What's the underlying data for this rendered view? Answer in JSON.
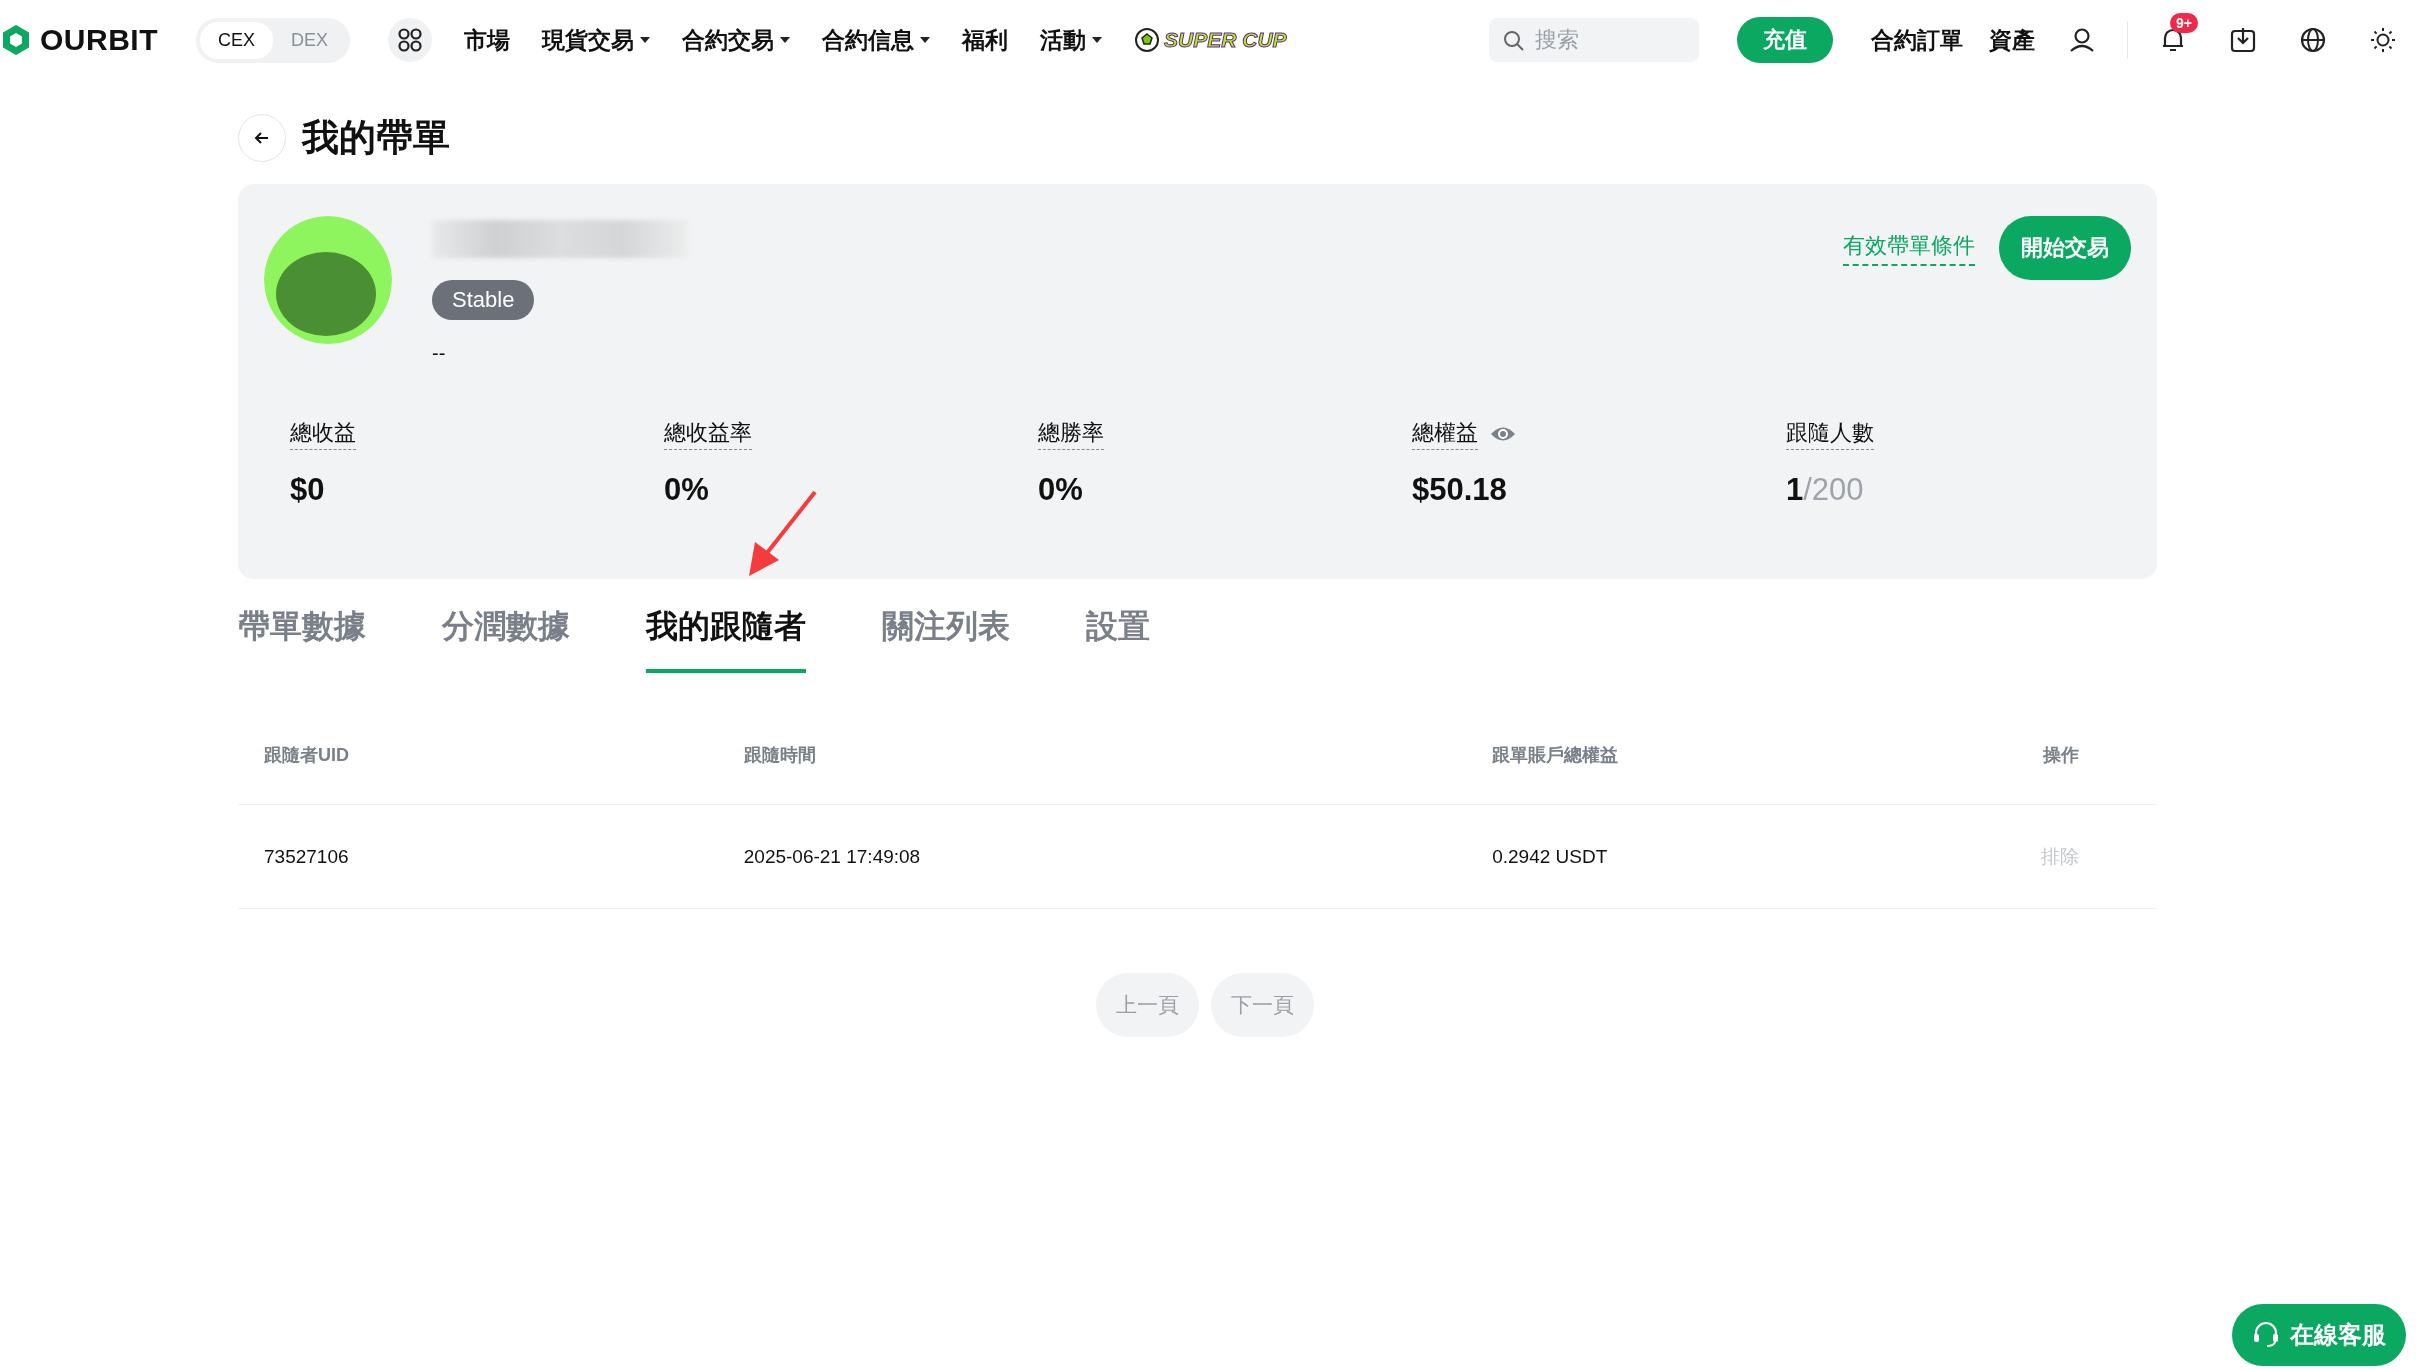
{
  "topbar": {
    "logo": "OURBIT",
    "mode_toggle": [
      {
        "label": "CEX",
        "selected": true
      },
      {
        "label": "DEX",
        "selected": false
      }
    ],
    "menu": [
      {
        "label": "市場",
        "dropdown": false
      },
      {
        "label": "現貨交易",
        "dropdown": true
      },
      {
        "label": "合約交易",
        "dropdown": true
      },
      {
        "label": "合約信息",
        "dropdown": true
      },
      {
        "label": "福利",
        "dropdown": false
      },
      {
        "label": "活動",
        "dropdown": true
      }
    ],
    "promo": "SUPER CUP",
    "search": {
      "placeholder": "搜索"
    },
    "deposit_button": "充值",
    "links": [
      "合約訂單",
      "資產"
    ],
    "notification_badge": "9+"
  },
  "page_title": "我的帶單",
  "profile": {
    "tag": "Stable",
    "bio": "--",
    "conditions_link": "有效帶單條件",
    "trade_button": "開始交易",
    "stats": [
      {
        "label": "總收益",
        "value": "$0",
        "eye": false
      },
      {
        "label": "總收益率",
        "value": "0%",
        "eye": false
      },
      {
        "label": "總勝率",
        "value": "0%",
        "eye": false
      },
      {
        "label": "總權益",
        "value": "$50.18",
        "eye": true
      },
      {
        "label": "跟隨人數",
        "value": "1",
        "total": "/200",
        "eye": false
      }
    ]
  },
  "tabs": [
    {
      "label": "帶單數據",
      "selected": false
    },
    {
      "label": "分潤數據",
      "selected": false
    },
    {
      "label": "我的跟隨者",
      "selected": true
    },
    {
      "label": "關注列表",
      "selected": false
    },
    {
      "label": "設置",
      "selected": false
    }
  ],
  "table": {
    "columns": [
      "跟隨者UID",
      "跟隨時間",
      "跟單賬戶總權益",
      "操作"
    ],
    "rows": [
      {
        "uid": "73527106",
        "time": "2025-06-21 17:49:08",
        "equity": "0.2942 USDT",
        "action": "排除",
        "action_disabled": true
      }
    ]
  },
  "pagination": [
    {
      "label": "上一頁",
      "disabled": true
    },
    {
      "label": "下一頁",
      "disabled": true
    }
  ],
  "support_button": "在線客服"
}
